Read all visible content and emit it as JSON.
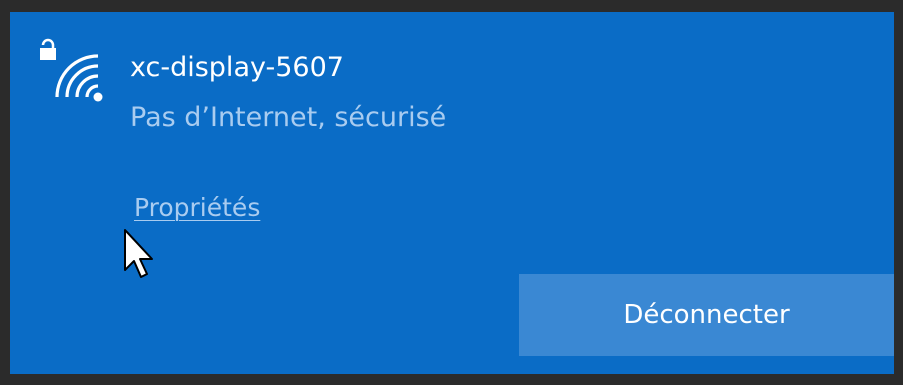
{
  "network": {
    "name": "xc-display-5607",
    "status": "Pas d’Internet, sécurisé",
    "icon": "wifi-secured-icon"
  },
  "links": {
    "properties_label": "Propriétés"
  },
  "actions": {
    "disconnect_label": "Déconnecter"
  },
  "colors": {
    "panel_background": "#0a6cc6",
    "button_background": "#3a88d3",
    "secondary_text": "#a9ccf0",
    "primary_text": "#ffffff"
  }
}
